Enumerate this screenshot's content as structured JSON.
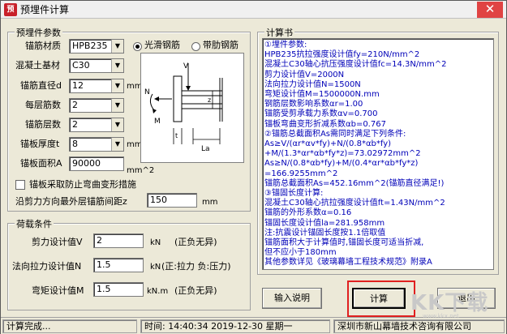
{
  "window": {
    "app_icon_text": "预",
    "title": "预埋件计算",
    "close_glyph": "✕"
  },
  "rebar_params": {
    "group_title": "预埋件参数",
    "material_label": "锚筋材质",
    "material_value": "HPB235",
    "rebar_type_options": [
      "光滑钢筋",
      "带肋钢筋"
    ],
    "rebar_type_selected": "光滑钢筋",
    "concrete_label": "混凝土基材",
    "concrete_value": "C30",
    "diameter_label": "锚筋直径d",
    "diameter_value": "12",
    "diameter_unit": "mm",
    "per_layer_label": "每层筋数",
    "per_layer_value": "2",
    "layers_label": "锚筋层数",
    "layers_value": "2",
    "thickness_label": "锚板厚度t",
    "thickness_value": "8",
    "thickness_unit": "mm",
    "area_label": "锚板面积A",
    "area_value": "90000",
    "area_unit": "mm^2",
    "prevent_bending_label": "锚板采取防止弯曲变形措施",
    "spacing_label": "沿剪力方向最外层锚筋间距z",
    "spacing_value": "150",
    "spacing_unit": "mm"
  },
  "diagram": {
    "label_v": "V",
    "label_n": "N",
    "label_m": "M",
    "label_z": "z",
    "label_t": "t",
    "label_la": "La"
  },
  "load_conditions": {
    "group_title": "荷载条件",
    "shear_label": "剪力设计值V",
    "shear_value": "2",
    "shear_unit": "kN",
    "shear_note": "(正负无异)",
    "tension_label": "法向拉力设计值N",
    "tension_value": "1.5",
    "tension_unit": "kN",
    "tension_note": "(正:拉力 负:压力)",
    "moment_label": "弯矩设计值M",
    "moment_value": "1.5",
    "moment_unit": "kN.m",
    "moment_note": "(正负无异)"
  },
  "calc_book": {
    "group_title": "计算书",
    "lines": [
      "①埋件参数:",
      "HPB235抗拉强度设计值fy=210N/mm^2",
      "混凝土C30轴心抗压强度设计值fc=14.3N/mm^2",
      "剪力设计值V=2000N",
      "法向拉力设计值N=1500N",
      "弯矩设计值M=1500000N.mm",
      "钢筋层数影响系数αr=1.00",
      "锚筋受剪承载力系数αv=0.700",
      "锚板弯曲变形折减系数αb=0.767",
      "②锚筋总截面积As需同时满足下列条件:",
      "As≥V/(αr*αv*fy)+N/(0.8*αb*fy)",
      "+M/(1.3*αr*αb*fy*z)=73.02972mm^2",
      "As≥N/(0.8*αb*fy)+M/(0.4*αr*αb*fy*z)",
      "=166.9255mm^2",
      "锚筋总截面积As=452.16mm^2(锚筋直径满足!)",
      "③锚固长度计算:",
      "混凝土C30轴心抗拉强度设计值ft=1.43N/mm^2",
      "锚筋的外形系数α=0.16",
      "锚固长度设计值la=281.958mm",
      "注:抗震设计锚固长度按1.1倍取值",
      "   锚筋面积大于计算值时,锚固长度可适当折减,",
      "   但不应小于180mm",
      "   其他参数详见《玻璃幕墙工程技术规范》附录A"
    ]
  },
  "buttons": {
    "input_help": "输入说明",
    "calculate": "计算",
    "exit": "退出"
  },
  "statusbar": {
    "status": "计算完成...",
    "time_label": "时间:",
    "time_value": "14:40:34 2019-12-30 星期一",
    "company": "深圳市新山幕墙技术咨询有限公司"
  },
  "watermark": {
    "main": "KK下载",
    "sub": "www.kkx.net"
  }
}
